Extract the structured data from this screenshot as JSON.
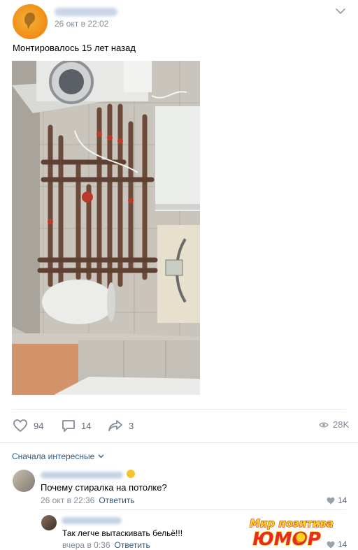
{
  "post": {
    "date": "26 окт в 22:02",
    "text": "Монтировалось 15 лет назад"
  },
  "actions": {
    "likes": "94",
    "comments": "14",
    "shares": "3",
    "views": "28K"
  },
  "comments_sort": "Сначала интересные",
  "comments": [
    {
      "text": "Почему стиралка на потолке?",
      "date": "26 окт в 22:36",
      "reply_label": "Ответить",
      "likes": "14"
    },
    {
      "text": "Так легче вытаскивать бельё!!!",
      "date": "вчера в 0:36",
      "reply_label": "Ответить",
      "likes": "14"
    }
  ],
  "watermark": {
    "line1": "Мир позитива",
    "line2": "ЮМОР"
  },
  "colors": {
    "link": "#2a5885",
    "meta": "#818c99",
    "avatar_accent": "#f08b14"
  },
  "icons": [
    "chevron-down-icon",
    "heart-icon",
    "comment-icon",
    "share-icon",
    "eye-icon"
  ]
}
